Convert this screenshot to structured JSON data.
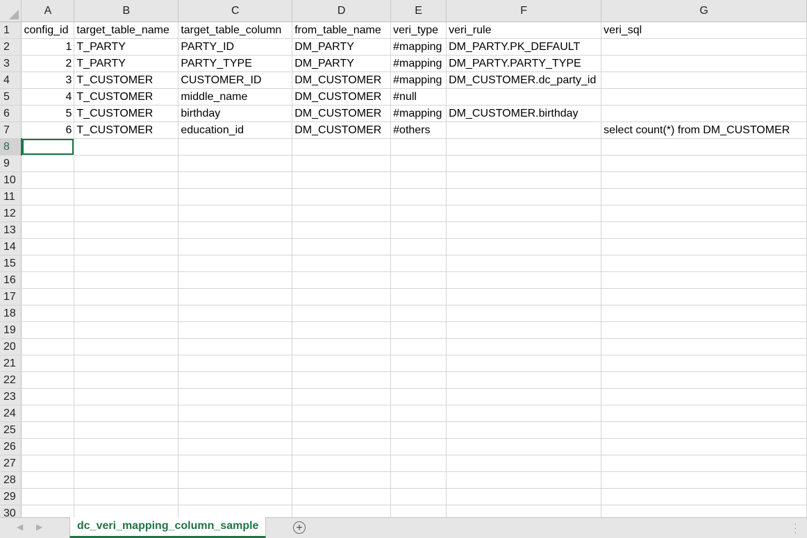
{
  "columns": [
    "A",
    "B",
    "C",
    "D",
    "E",
    "F",
    "G"
  ],
  "rows": [
    {
      "n": "1",
      "cells": [
        "config_id",
        "target_table_name",
        "target_table_column",
        "from_table_name",
        "veri_type",
        "veri_rule",
        "veri_sql"
      ],
      "align": [
        "l",
        "l",
        "l",
        "l",
        "l",
        "l",
        "l"
      ]
    },
    {
      "n": "2",
      "cells": [
        "1",
        "T_PARTY",
        "PARTY_ID",
        "DM_PARTY",
        "#mapping",
        "DM_PARTY.PK_DEFAULT",
        ""
      ],
      "align": [
        "r",
        "l",
        "l",
        "l",
        "l",
        "l",
        "l"
      ]
    },
    {
      "n": "3",
      "cells": [
        "2",
        "T_PARTY",
        "PARTY_TYPE",
        "DM_PARTY",
        "#mapping",
        "DM_PARTY.PARTY_TYPE",
        ""
      ],
      "align": [
        "r",
        "l",
        "l",
        "l",
        "l",
        "l",
        "l"
      ]
    },
    {
      "n": "4",
      "cells": [
        "3",
        "T_CUSTOMER",
        "CUSTOMER_ID",
        "DM_CUSTOMER",
        "#mapping",
        "DM_CUSTOMER.dc_party_id",
        ""
      ],
      "align": [
        "r",
        "l",
        "l",
        "l",
        "l",
        "l",
        "l"
      ]
    },
    {
      "n": "5",
      "cells": [
        "4",
        "T_CUSTOMER",
        "middle_name",
        "DM_CUSTOMER",
        "#null",
        "",
        ""
      ],
      "align": [
        "r",
        "l",
        "l",
        "l",
        "l",
        "l",
        "l"
      ]
    },
    {
      "n": "6",
      "cells": [
        "5",
        "T_CUSTOMER",
        "birthday",
        "DM_CUSTOMER",
        "#mapping",
        "DM_CUSTOMER.birthday",
        ""
      ],
      "align": [
        "r",
        "l",
        "l",
        "l",
        "l",
        "l",
        "l"
      ]
    },
    {
      "n": "7",
      "cells": [
        "6",
        "T_CUSTOMER",
        "education_id",
        "DM_CUSTOMER",
        "#others",
        "",
        "select count(*) from DM_CUSTOMER"
      ],
      "align": [
        "r",
        "l",
        "l",
        "l",
        "l",
        "l",
        "l"
      ]
    },
    {
      "n": "8",
      "cells": [
        "",
        "",
        "",
        "",
        "",
        "",
        ""
      ]
    },
    {
      "n": "9",
      "cells": [
        "",
        "",
        "",
        "",
        "",
        "",
        ""
      ]
    },
    {
      "n": "10",
      "cells": [
        "",
        "",
        "",
        "",
        "",
        "",
        ""
      ]
    },
    {
      "n": "11",
      "cells": [
        "",
        "",
        "",
        "",
        "",
        "",
        ""
      ]
    },
    {
      "n": "12",
      "cells": [
        "",
        "",
        "",
        "",
        "",
        "",
        ""
      ]
    },
    {
      "n": "13",
      "cells": [
        "",
        "",
        "",
        "",
        "",
        "",
        ""
      ]
    },
    {
      "n": "14",
      "cells": [
        "",
        "",
        "",
        "",
        "",
        "",
        ""
      ]
    },
    {
      "n": "15",
      "cells": [
        "",
        "",
        "",
        "",
        "",
        "",
        ""
      ]
    },
    {
      "n": "16",
      "cells": [
        "",
        "",
        "",
        "",
        "",
        "",
        ""
      ]
    },
    {
      "n": "17",
      "cells": [
        "",
        "",
        "",
        "",
        "",
        "",
        ""
      ]
    },
    {
      "n": "18",
      "cells": [
        "",
        "",
        "",
        "",
        "",
        "",
        ""
      ]
    },
    {
      "n": "19",
      "cells": [
        "",
        "",
        "",
        "",
        "",
        "",
        ""
      ]
    },
    {
      "n": "20",
      "cells": [
        "",
        "",
        "",
        "",
        "",
        "",
        ""
      ]
    },
    {
      "n": "21",
      "cells": [
        "",
        "",
        "",
        "",
        "",
        "",
        ""
      ]
    },
    {
      "n": "22",
      "cells": [
        "",
        "",
        "",
        "",
        "",
        "",
        ""
      ]
    },
    {
      "n": "23",
      "cells": [
        "",
        "",
        "",
        "",
        "",
        "",
        ""
      ]
    },
    {
      "n": "24",
      "cells": [
        "",
        "",
        "",
        "",
        "",
        "",
        ""
      ]
    },
    {
      "n": "25",
      "cells": [
        "",
        "",
        "",
        "",
        "",
        "",
        ""
      ]
    },
    {
      "n": "26",
      "cells": [
        "",
        "",
        "",
        "",
        "",
        "",
        ""
      ]
    },
    {
      "n": "27",
      "cells": [
        "",
        "",
        "",
        "",
        "",
        "",
        ""
      ]
    },
    {
      "n": "28",
      "cells": [
        "",
        "",
        "",
        "",
        "",
        "",
        ""
      ]
    },
    {
      "n": "29",
      "cells": [
        "",
        "",
        "",
        "",
        "",
        "",
        ""
      ]
    },
    {
      "n": "30",
      "cells": [
        "",
        "",
        "",
        "",
        "",
        "",
        ""
      ]
    }
  ],
  "active_cell": {
    "row": "8",
    "col": "A"
  },
  "sheet_tab": {
    "label": "dc_veri_mapping_column_sample"
  },
  "add_sheet_glyph": "+",
  "colors": {
    "accent": "#217346",
    "header_bg": "#e6e6e6",
    "grid": "#d4d4d4"
  },
  "icons": {
    "prev_sheet": "triangle-left-icon",
    "next_sheet": "triangle-right-icon",
    "add_sheet": "plus-circle-icon",
    "more": "vertical-dots-icon"
  }
}
